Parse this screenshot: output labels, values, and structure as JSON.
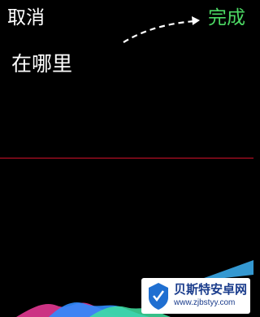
{
  "toolbar": {
    "cancel_label": "取消",
    "done_label": "完成"
  },
  "dictation": {
    "text": "在哪里"
  },
  "watermark": {
    "name": "贝斯特安卓网",
    "url": "www.zjbstyy.com"
  },
  "colors": {
    "background": "#000000",
    "done": "#4cd964",
    "cursor_line": "#d0102a",
    "watermark_text": "#1a3c8c"
  },
  "icons": {
    "arrow": "dashed-arrow-icon",
    "logo": "shield-logo-icon"
  }
}
